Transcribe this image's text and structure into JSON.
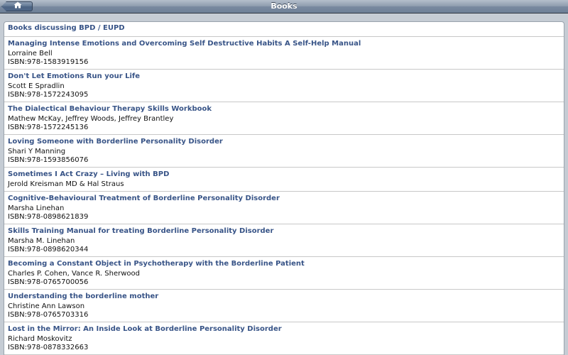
{
  "navbar": {
    "title": "Books",
    "home_icon": "home-icon"
  },
  "list": {
    "header": "Books discussing BPD / EUPD",
    "books": [
      {
        "title": "Managing Intense Emotions and Overcoming Self Destructive Habits A Self-Help Manual",
        "author": "Lorraine Bell",
        "isbn": "ISBN:978-1583919156"
      },
      {
        "title": "Don't Let Emotions Run your Life",
        "author": "Scott E Spradlin",
        "isbn": "ISBN:978-1572243095"
      },
      {
        "title": "The Dialectical Behaviour Therapy Skills Workbook",
        "author": "Mathew McKay, Jeffrey Woods, Jeffrey Brantley",
        "isbn": "ISBN:978-1572245136"
      },
      {
        "title": "Loving Someone with Borderline Personality Disorder",
        "author": "Shari Y Manning",
        "isbn": "ISBN:978-1593856076"
      },
      {
        "title": "Sometimes I Act Crazy – Living with BPD",
        "author": "Jerold Kreisman MD & Hal Straus",
        "isbn": ""
      },
      {
        "title": "Cognitive-Behavioural Treatment of Borderline Personality Disorder",
        "author": "Marsha Linehan",
        "isbn": "ISBN:978-0898621839"
      },
      {
        "title": "Skills Training Manual for treating Borderline Personality Disorder",
        "author": "Marsha M. Linehan",
        "isbn": "ISBN:978-0898620344"
      },
      {
        "title": "Becoming a Constant Object in Psychotherapy with the Borderline Patient",
        "author": "Charles P. Cohen, Vance R. Sherwood",
        "isbn": "ISBN:978-0765700056"
      },
      {
        "title": "Understanding the borderline mother",
        "author": "Christine Ann Lawson",
        "isbn": "ISBN:978-0765703316"
      },
      {
        "title": "Lost in the Mirror: An Inside Look at Borderline Personality Disorder",
        "author": "Richard Moskovitz",
        "isbn": "ISBN:978-0878332663"
      }
    ]
  }
}
